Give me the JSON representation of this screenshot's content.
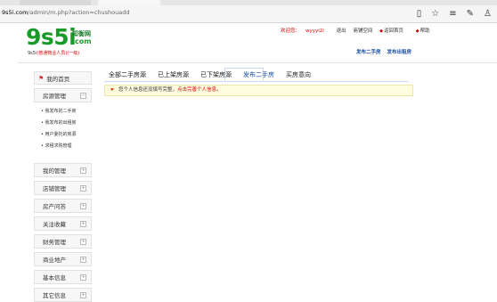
{
  "browser": {
    "url_domain": "9s5i.com",
    "url_path": "/admin/m.php?action=chushouadd"
  },
  "logo": {
    "main": "9s5i",
    "cn": "知衡网",
    "com": ".com",
    "tag_left": "9s5i",
    "tag_red": "(普通物业人员)",
    "tag_right": "(一级)"
  },
  "toplinks": {
    "welcome": "欢迎您：",
    "user": "wyyyi2i",
    "logout": "退出",
    "site_home": "商铺空间",
    "back_home": "返回首页",
    "help": "帮助"
  },
  "publish": {
    "sell": "发布二手房",
    "rent": "发布出租房"
  },
  "sidebar": {
    "home": "我的首页",
    "groups": [
      {
        "label": "房源管理",
        "expanded": true,
        "items": [
          "我发布的二手房",
          "我发布的出租房",
          "用户委托的房源",
          "求租求购管理"
        ]
      },
      {
        "label": "我的管理",
        "expanded": false
      },
      {
        "label": "店铺管理",
        "expanded": false
      },
      {
        "label": "房产问答",
        "expanded": false
      },
      {
        "label": "关注收藏",
        "expanded": false
      },
      {
        "label": "财务管理",
        "expanded": false
      },
      {
        "label": "商业地产",
        "expanded": false
      },
      {
        "label": "基本信息",
        "expanded": false
      },
      {
        "label": "其它信息",
        "expanded": false
      }
    ]
  },
  "main": {
    "tabs": [
      "全部二手房源",
      "已上架房源",
      "已下架房源",
      "发布二手房",
      "买房意向"
    ],
    "active_tab": "发布二手房",
    "notice": {
      "text": "您个人信息还没填写完整，",
      "link": "点击完善个人信息。"
    }
  }
}
